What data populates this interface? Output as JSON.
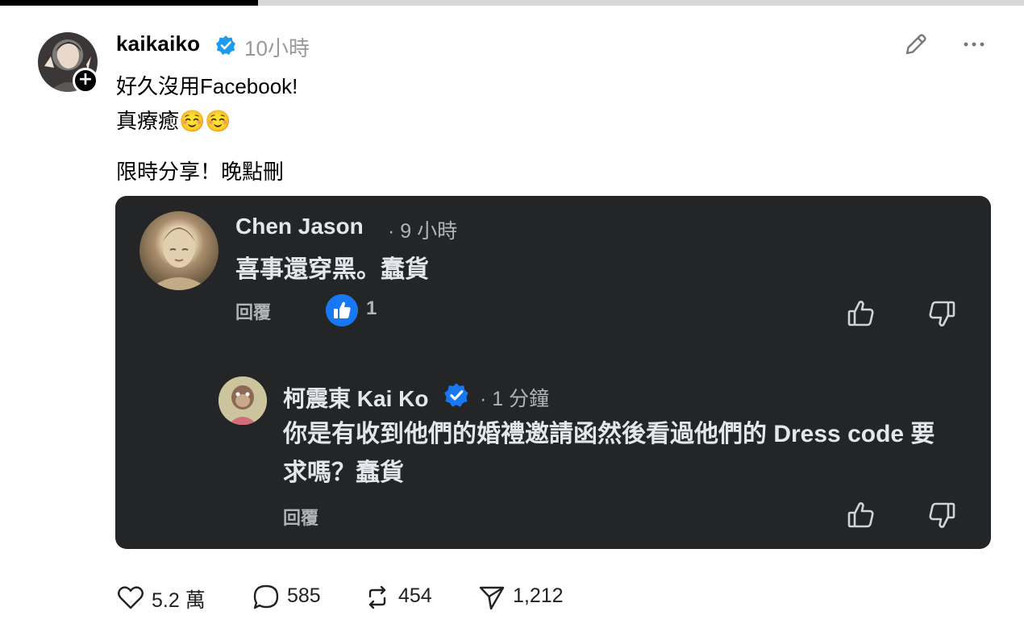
{
  "post": {
    "username": "kaikaiko",
    "time": "10小時",
    "lines": [
      "好久沒用Facebook!",
      "真療癒☺️☺️",
      "限時分享！晚點刪"
    ]
  },
  "embedded_comment": {
    "author": "Chen Jason",
    "time": "· 9 小時",
    "text": "喜事還穿黑。蠢貨",
    "reply_label": "回覆",
    "like_count": "1"
  },
  "embedded_reply": {
    "author": "柯震東 Kai Ko",
    "time": "· 1 分鐘",
    "text": "你是有收到他們的婚禮邀請函然後看過他們的 Dress code 要求嗎？蠢貨",
    "reply_label": "回覆"
  },
  "stats": {
    "likes": "5.2 萬",
    "comments": "585",
    "reposts": "454",
    "shares": "1,212"
  },
  "colors": {
    "verified_blue": "#1d9bf0",
    "facebook_blue": "#1877f2",
    "card_background": "#242526"
  }
}
